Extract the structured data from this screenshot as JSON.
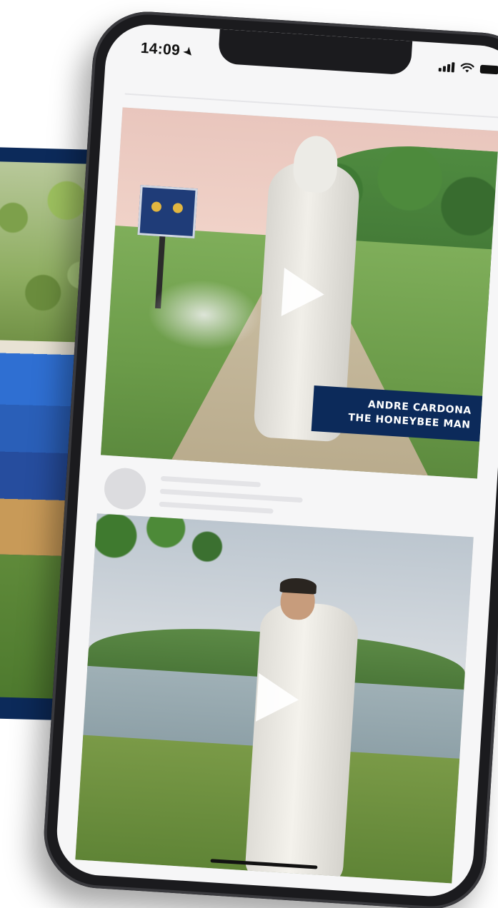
{
  "status_bar": {
    "time": "14:09",
    "location_icon": "location-arrow-icon",
    "signal_icon": "cellular-signal-icon",
    "wifi_icon": "wifi-icon",
    "battery_icon": "battery-icon"
  },
  "feed": {
    "video_1": {
      "caption_line_1": "ANDRE CARDONA",
      "caption_line_2": "THE HONEYBEE MAN",
      "play_icon": "play-icon"
    },
    "video_2": {
      "play_icon": "play-icon"
    }
  },
  "colors": {
    "caption_background": "#0c2a5a",
    "caption_text": "#ffffff",
    "screen_background": "#f6f6f7"
  }
}
